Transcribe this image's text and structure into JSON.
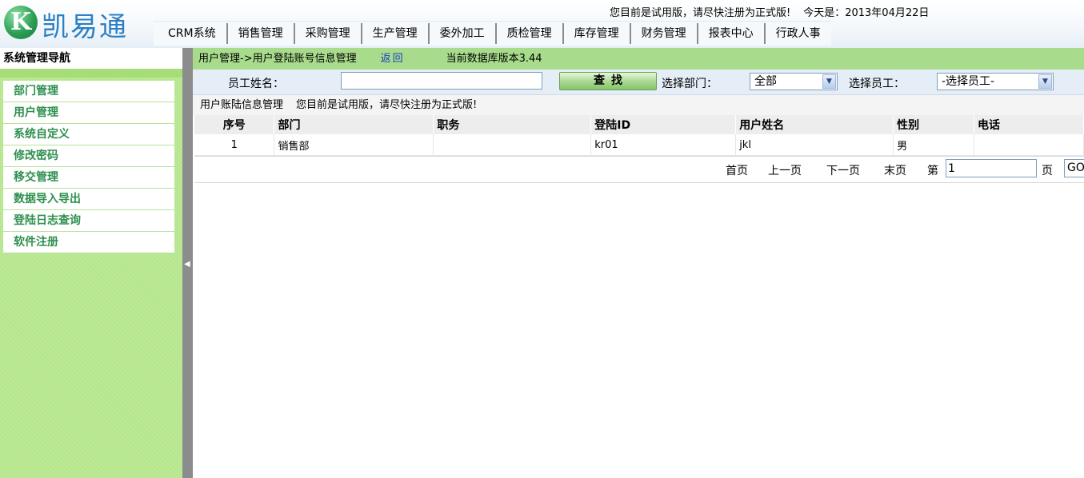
{
  "header": {
    "logo_letter": "K",
    "logo_text": "凯易通",
    "trial_notice": "您目前是试用版，请尽快注册为正式版!",
    "date_label": "今天是：2013年04月22日",
    "nav": [
      "CRM系统",
      "销售管理",
      "采购管理",
      "生产管理",
      "委外加工",
      "质检管理",
      "库存管理",
      "财务管理",
      "报表中心",
      "行政人事"
    ]
  },
  "sidebar": {
    "title": "系统管理导航",
    "items": [
      "部门管理",
      "用户管理",
      "系统自定义",
      "修改密码",
      "移交管理",
      "数据导入导出",
      "登陆日志查询",
      "软件注册"
    ]
  },
  "breadcrumb": {
    "path": "用户管理->用户登陆账号信息管理",
    "back": "返回",
    "db_version": "当前数据库版本3.44"
  },
  "search": {
    "employee_name_label": "员工姓名：",
    "employee_name_value": "",
    "search_button": "查找",
    "dept_label": "选择部门：",
    "dept_selected": "全部",
    "employee_label": "选择员工：",
    "employee_selected": "-选择员工-"
  },
  "table": {
    "title": "用户账陆信息管理",
    "notice": "您目前是试用版，请尽快注册为正式版!",
    "columns": [
      "序号",
      "部门",
      "职务",
      "登陆ID",
      "用户姓名",
      "性别",
      "电话"
    ],
    "rows": [
      [
        "1",
        "销售部",
        "",
        "kr01",
        "jkl",
        "男",
        ""
      ]
    ]
  },
  "pager": {
    "first": "首页",
    "prev": "上一页",
    "next": "下一页",
    "last": "末页",
    "page_prefix": "第",
    "page_value": "1",
    "page_suffix": "页",
    "go": "GO"
  },
  "colors": {
    "sidebar_bg": "#b5e68c",
    "sidebar_item_text": "#2d8f4e",
    "crumb_bg": "#a8dc8c",
    "logo_blue": "#2b7fc4",
    "link_blue": "#1a3fbf"
  }
}
